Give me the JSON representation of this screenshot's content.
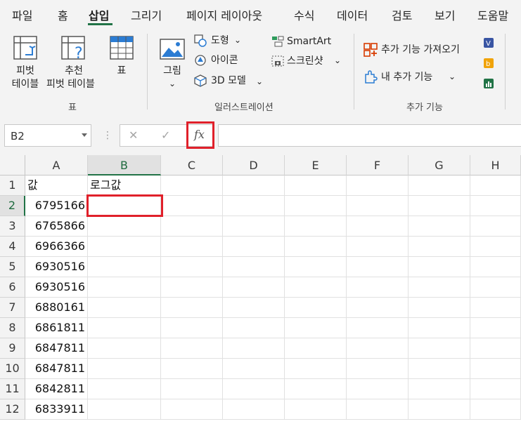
{
  "ribbon_tabs": [
    "파일",
    "홈",
    "삽입",
    "그리기",
    "페이지 레이아웃",
    "수식",
    "데이터",
    "검토",
    "보기",
    "도움말"
  ],
  "active_tab": "삽입",
  "groups": {
    "table": {
      "label": "표",
      "pivot_line1": "피벗",
      "pivot_line2": "테이블",
      "recommended_line1": "추천",
      "recommended_line2": "피벗 테이블",
      "table_btn": "표"
    },
    "illustrations": {
      "label": "일러스트레이션",
      "picture": "그림",
      "shapes": "도형",
      "icons": "아이콘",
      "models3d": "3D 모델",
      "smartart": "SmartArt",
      "screenshot": "스크린샷"
    },
    "addins": {
      "label": "추가 기능",
      "get_addins": "추가 기능 가져오기",
      "my_addins": "내 추가 기능"
    }
  },
  "formula_bar": {
    "name_box": "B2",
    "cancel_glyph": "✕",
    "enter_glyph": "✓",
    "fx_label": "fx",
    "formula": ""
  },
  "columns": [
    "A",
    "B",
    "C",
    "D",
    "E",
    "F",
    "G",
    "H"
  ],
  "selected_column": "B",
  "selected_row": "2",
  "rows": [
    {
      "n": "1",
      "a": "값",
      "b": "로그값"
    },
    {
      "n": "2",
      "a": "6795166",
      "b": ""
    },
    {
      "n": "3",
      "a": "6765866",
      "b": ""
    },
    {
      "n": "4",
      "a": "6966366",
      "b": ""
    },
    {
      "n": "5",
      "a": "6930516",
      "b": ""
    },
    {
      "n": "6",
      "a": "6930516",
      "b": ""
    },
    {
      "n": "7",
      "a": "6880161",
      "b": ""
    },
    {
      "n": "8",
      "a": "6861811",
      "b": ""
    },
    {
      "n": "9",
      "a": "6847811",
      "b": ""
    },
    {
      "n": "10",
      "a": "6847811",
      "b": ""
    },
    {
      "n": "11",
      "a": "6842811",
      "b": ""
    },
    {
      "n": "12",
      "a": "6833911",
      "b": ""
    }
  ],
  "colors": {
    "accent": "#217346",
    "highlight": "#e0202a"
  }
}
